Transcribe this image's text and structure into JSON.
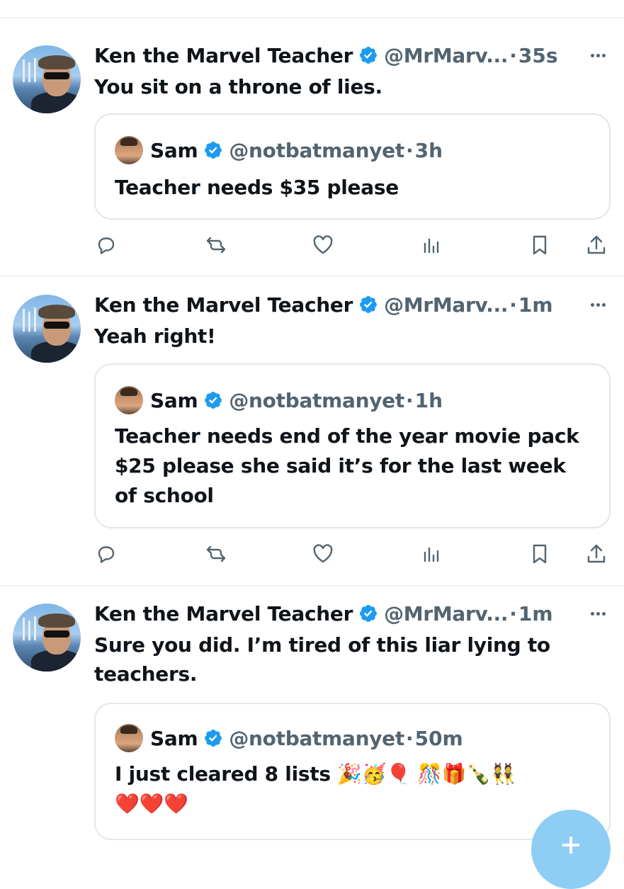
{
  "colors": {
    "verified": "#1d9bf0",
    "secondary_text": "#536471",
    "border": "#e1e8ed",
    "fab": "#8ecdf4"
  },
  "posts": [
    {
      "author_name": "Ken the Marvel Teacher",
      "handle": "@MrMarv...",
      "separator": "·",
      "time": "35s",
      "text": "You sit on a throne of lies.",
      "quote": {
        "author_name": "Sam",
        "handle": "@notbatmanyet",
        "separator": "·",
        "time": "3h",
        "text": "Teacher needs $35 please"
      }
    },
    {
      "author_name": "Ken the Marvel Teacher",
      "handle": "@MrMarv...",
      "separator": "·",
      "time": "1m",
      "text": "Yeah right!",
      "quote": {
        "author_name": "Sam",
        "handle": "@notbatmanyet",
        "separator": "·",
        "time": "1h",
        "text_lines": [
          "Teacher needs end of the year movie pack",
          "$25 please she said it’s for the last week",
          "of school"
        ]
      }
    },
    {
      "author_name": "Ken the Marvel Teacher",
      "handle": "@MrMarv...",
      "separator": "·",
      "time": "1m",
      "text_lines": [
        "Sure you did. I’m tired of this liar lying to",
        "teachers."
      ],
      "quote": {
        "author_name": "Sam",
        "handle": "@notbatmanyet",
        "separator": "·",
        "time": "50m",
        "text_lines": [
          "I just cleared 8 lists 🎉🥳🎈 🎊🎁🍾👯",
          "❤️❤️❤️"
        ]
      }
    }
  ],
  "icons": {
    "reply": "reply-icon",
    "repost": "repost-icon",
    "like": "heart-icon",
    "views": "views-icon",
    "bookmark": "bookmark-icon",
    "share": "share-icon",
    "more": "more-icon",
    "compose": "compose-plus-icon"
  }
}
